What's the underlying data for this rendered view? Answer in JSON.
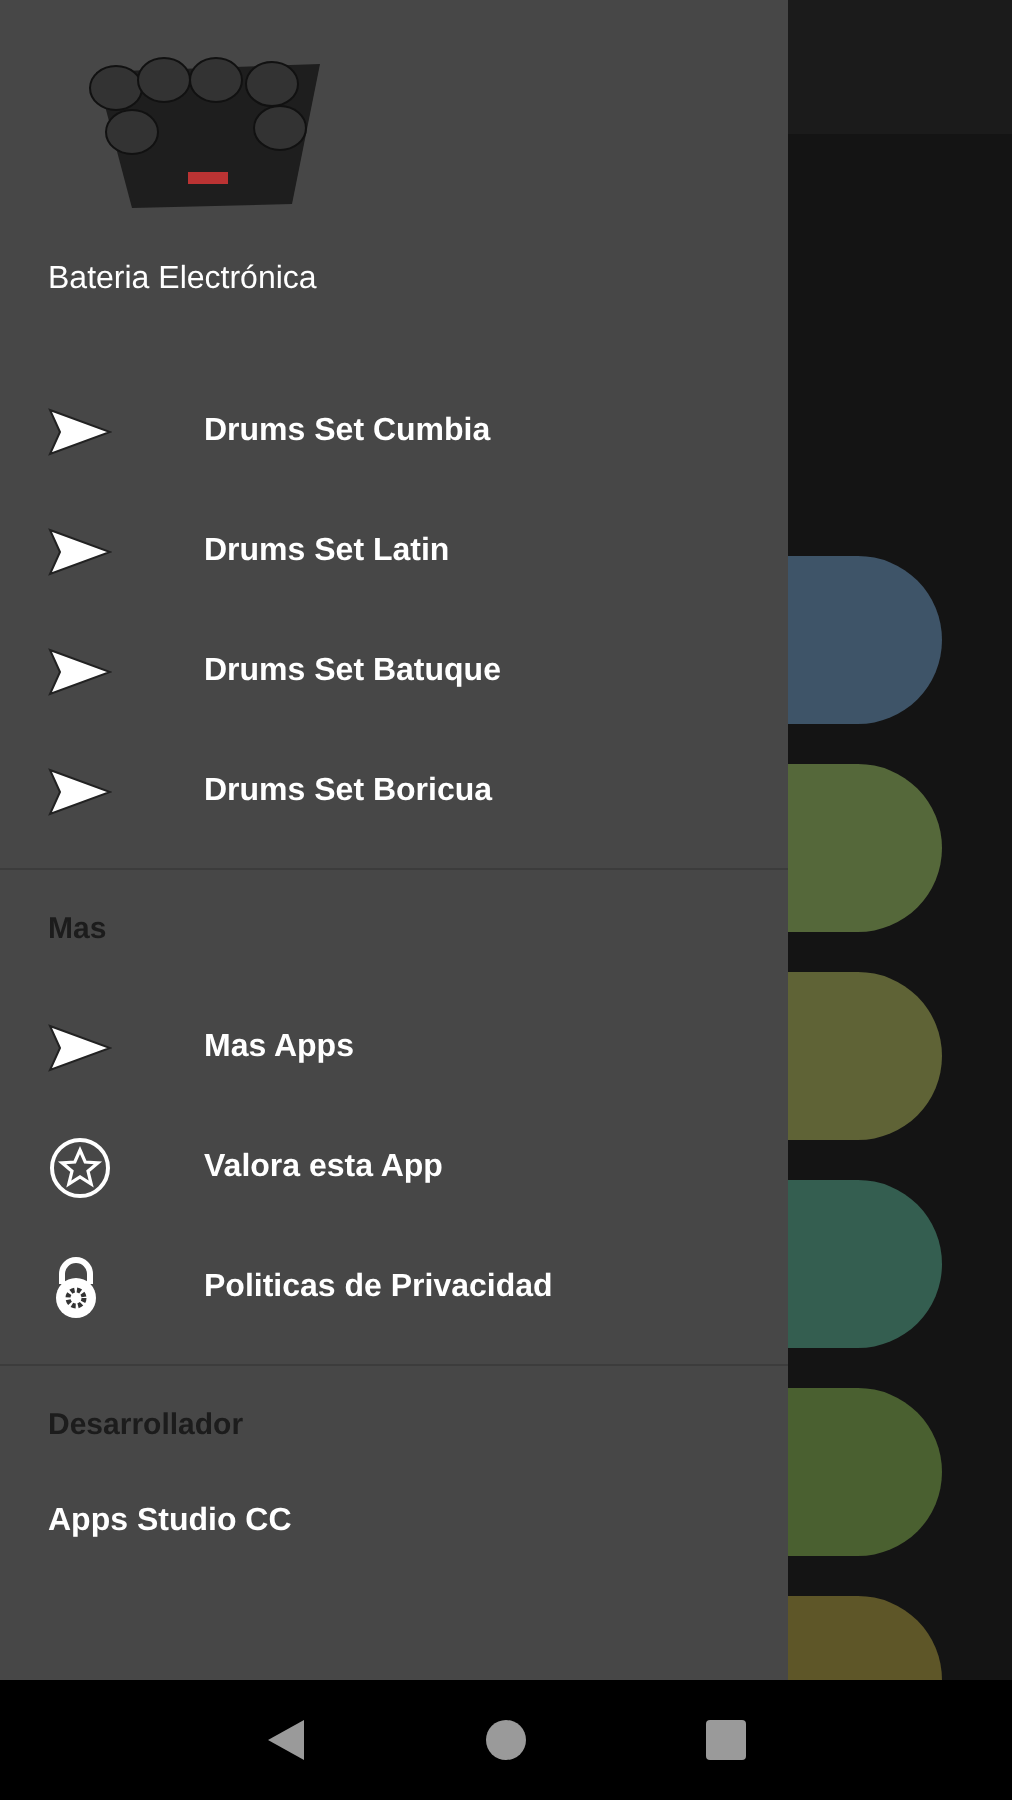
{
  "drawer": {
    "title": "Bateria Electrónica",
    "sections": [
      {
        "items": [
          {
            "kind": "send",
            "label": "Drums Set Cumbia"
          },
          {
            "kind": "send",
            "label": "Drums Set Latin"
          },
          {
            "kind": "send",
            "label": "Drums Set Batuque"
          },
          {
            "kind": "send",
            "label": "Drums Set Boricua"
          }
        ]
      },
      {
        "heading": "Mas",
        "items": [
          {
            "kind": "send",
            "label": "Mas Apps"
          },
          {
            "kind": "star",
            "label": "Valora esta App"
          },
          {
            "kind": "lock",
            "label": "Politicas de Privacidad"
          }
        ]
      },
      {
        "heading": "Desarrollador",
        "items": [
          {
            "kind": "text",
            "label": "Apps Studio CC"
          }
        ]
      }
    ]
  },
  "pills": [
    {
      "color": "#3e5468"
    },
    {
      "color": "#55683a"
    },
    {
      "color": "#5f6336"
    },
    {
      "color": "#345e50"
    },
    {
      "color": "#4a6030"
    },
    {
      "color": "#5e5628"
    }
  ]
}
